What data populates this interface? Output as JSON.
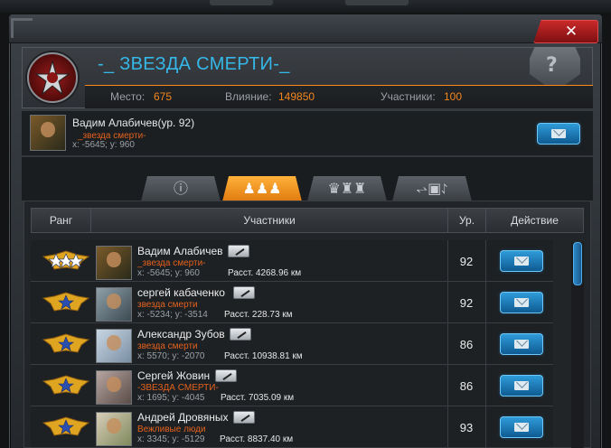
{
  "clan": {
    "name": "-_ ЗВЕЗДА СМЕРТИ-_",
    "stats": [
      {
        "label": "Место:",
        "value": "675"
      },
      {
        "label": "Влияние:",
        "value": "149850"
      },
      {
        "label": "Участники:",
        "value": "100"
      }
    ]
  },
  "leader": {
    "name": "Вадим Алабичев(ур. 92)",
    "clan": "_звезда смерти-",
    "coords": "x: -5645; y: 960"
  },
  "tabs": [
    {
      "icon": "info-icon",
      "glyph": "ⓘ",
      "active": false
    },
    {
      "icon": "members-icon",
      "glyph": "♟♟♟",
      "active": true
    },
    {
      "icon": "chess-icon",
      "glyph": "♛♜♜",
      "active": false
    },
    {
      "icon": "wings-icon",
      "glyph": "⥋▣⥌",
      "active": false
    }
  ],
  "table": {
    "headers": {
      "rank": "Ранг",
      "members": "Участники",
      "level": "Ур.",
      "action": "Действие"
    },
    "rows": [
      {
        "name": "Вадим Алабичев",
        "clan": "_звезда смерти-",
        "coords": "x: -5645; y: 960",
        "distance": "Расст. 4268.96 км",
        "level": "92",
        "stars": 3
      },
      {
        "name": "сергей кабаченко",
        "clan": "звезда смерти",
        "coords": "x: -5234; y: -3514",
        "distance": "Расст. 228.73 км",
        "level": "92",
        "stars": 1
      },
      {
        "name": "Александр Зубов",
        "clan": "звезда смерти",
        "coords": "x: 5570; y: -2070",
        "distance": "Расст. 10938.81 км",
        "level": "86",
        "stars": 1
      },
      {
        "name": "Сергей Жовин",
        "clan": "-ЗВЕЗДА СМЕРТИ-",
        "coords": "x: 1695; y: -4045",
        "distance": "Расст. 7035.09 км",
        "level": "86",
        "stars": 1
      },
      {
        "name": "Андрей Дровяных",
        "clan": "Вежливые люди",
        "coords": "x: 3345; y: -5129",
        "distance": "Расст. 8837.40 км",
        "level": "93",
        "stars": 1
      }
    ]
  },
  "close_label": "✕",
  "shield_glyph": "?",
  "colors": {
    "accent": "#f2861e",
    "clan_name": "#35b8e8",
    "clan_tag": "#e3611d",
    "mail_button": "#2f9bd9"
  }
}
